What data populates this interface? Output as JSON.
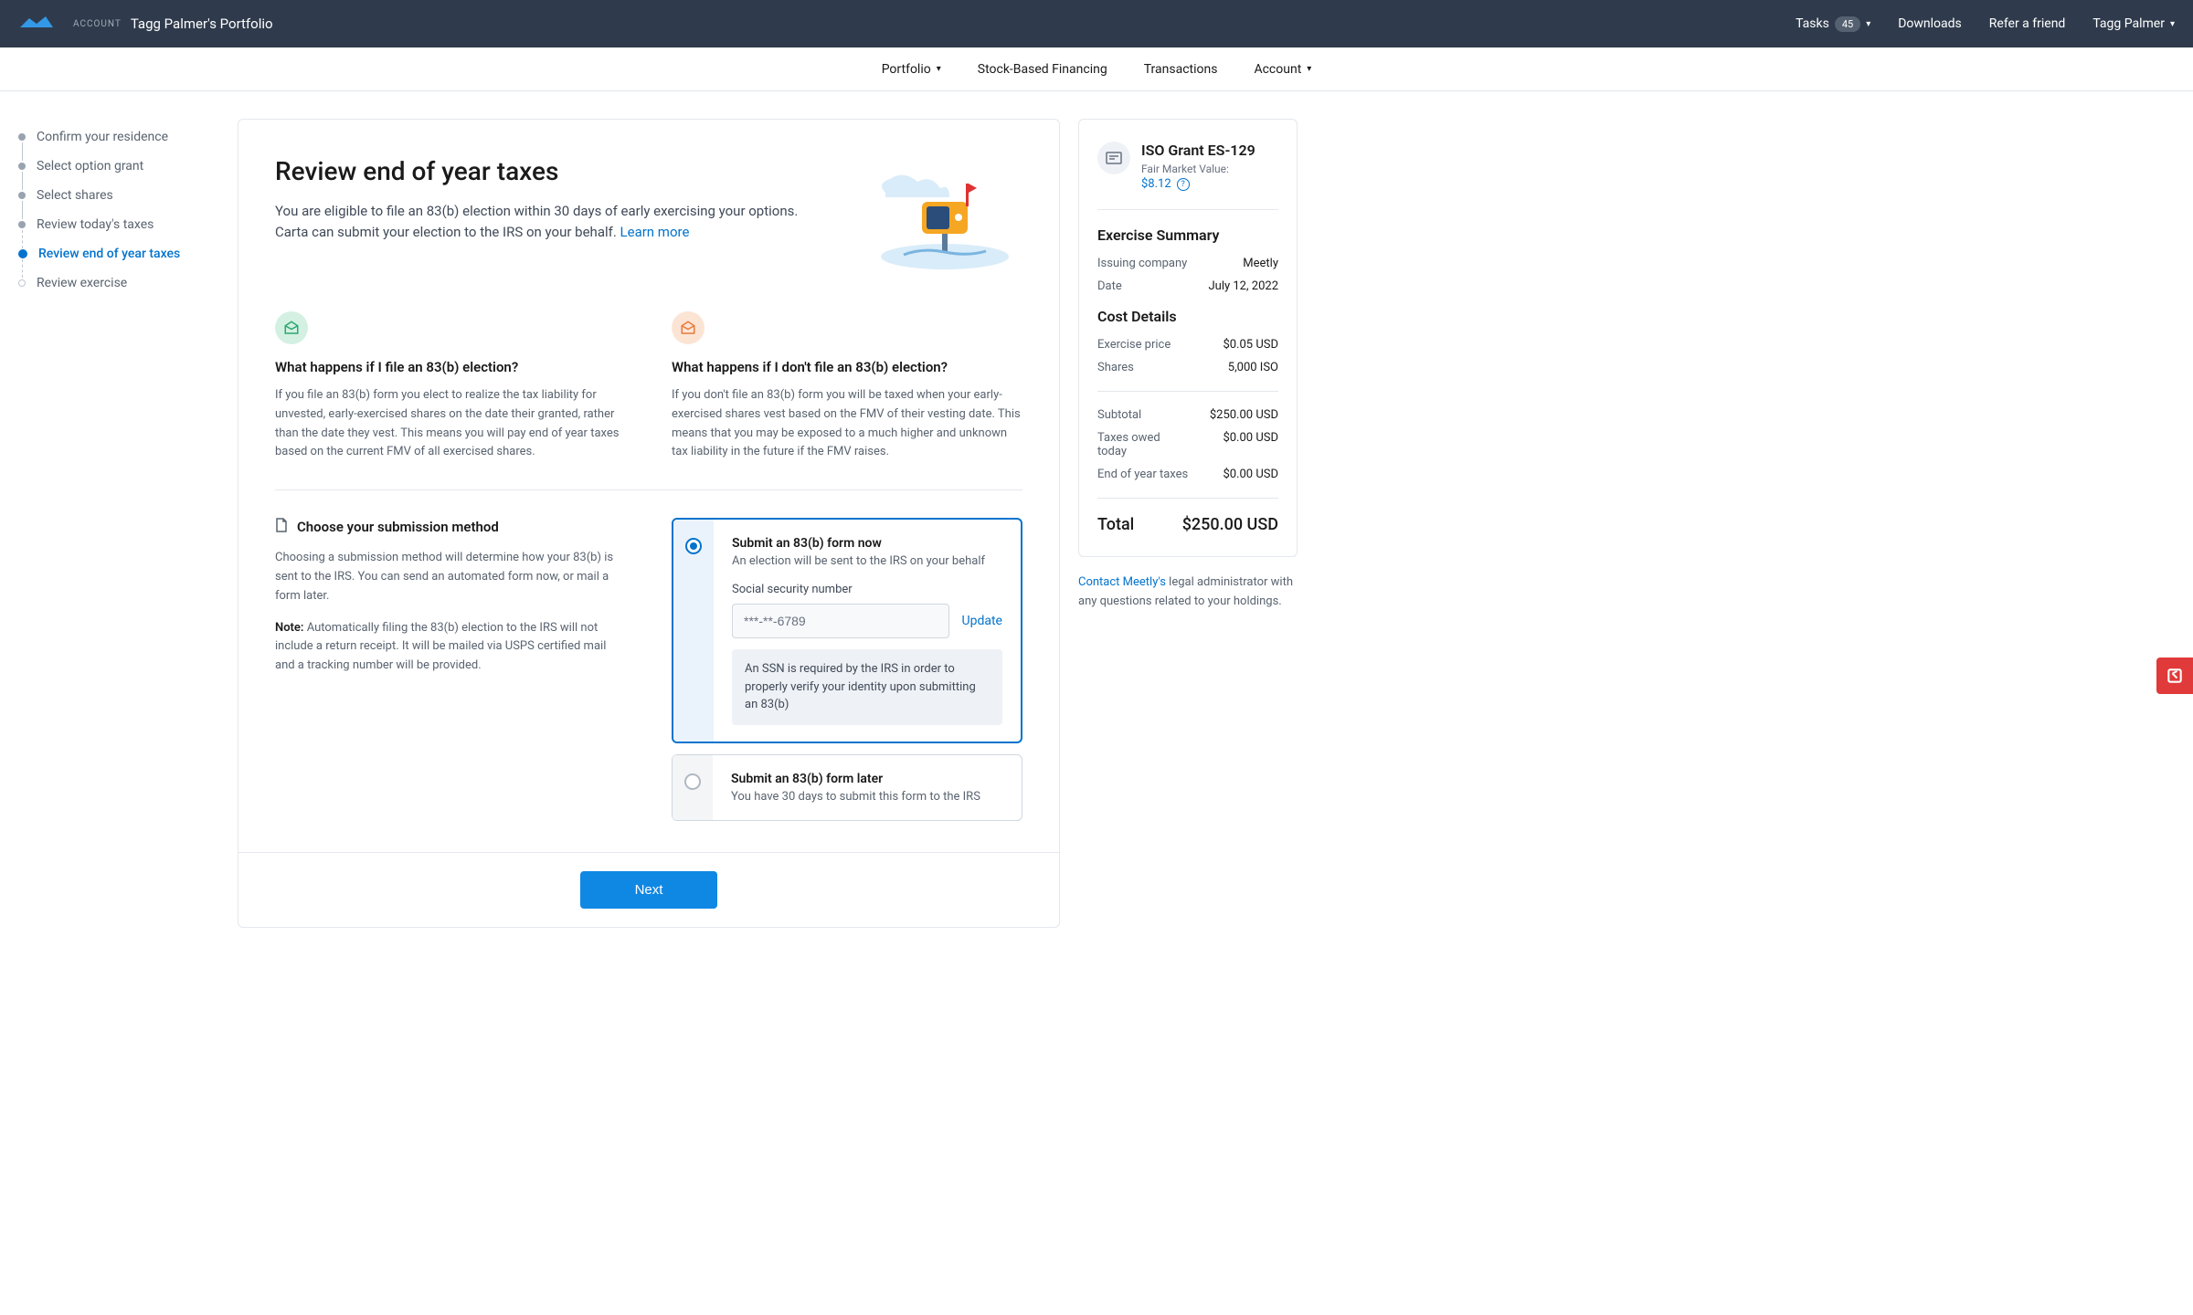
{
  "header": {
    "account_label": "ACCOUNT",
    "portfolio_name": "Tagg Palmer's Portfolio",
    "tasks_label": "Tasks",
    "tasks_count": "45",
    "downloads": "Downloads",
    "refer": "Refer a friend",
    "user_name": "Tagg Palmer"
  },
  "subnav": {
    "portfolio": "Portfolio",
    "financing": "Stock-Based Financing",
    "transactions": "Transactions",
    "account": "Account"
  },
  "steps": [
    {
      "label": "Confirm your residence"
    },
    {
      "label": "Select option grant"
    },
    {
      "label": "Select shares"
    },
    {
      "label": "Review today's taxes"
    },
    {
      "label": "Review end of year taxes"
    },
    {
      "label": "Review exercise"
    }
  ],
  "main": {
    "title": "Review end of year taxes",
    "desc": "You are eligible to file an 83(b) election within 30 days of early exercising your options. Carta can submit your election to the IRS on your behalf.",
    "learn_more": "Learn more",
    "col1_title": "What happens if I file an 83(b) election?",
    "col1_text": "If you file an 83(b) form you elect to realize the tax liability for unvested, early-exercised shares on the date their granted, rather than the date they vest. This means you will pay end of year taxes based on the current FMV of all exercised shares.",
    "col2_title": "What happens if I don't file an 83(b) election?",
    "col2_text": "If you don't file an 83(b) form you will be taxed when your early-exercised shares vest based on the FMV of their vesting date. This means that you may be exposed to a much higher and unknown tax liability in the future if the FMV raises.",
    "sub_heading": "Choose your submission method",
    "sub_text": "Choosing a submission method will determine how your 83(b) is sent to the IRS. You can send an automated form now, or mail a form later.",
    "note_label": "Note:",
    "note_text": " Automatically filing the 83(b) election to the IRS will not include a return receipt. It will be mailed via USPS certified mail and a tracking number will be provided.",
    "opt1_title": "Submit an 83(b) form now",
    "opt1_sub": "An election will be sent to the IRS on your behalf",
    "ssn_label": "Social security number",
    "ssn_value": "***-**-6789",
    "update": "Update",
    "ssn_note": "An SSN is required by the IRS in order to properly verify your identity upon submitting an 83(b)",
    "opt2_title": "Submit an 83(b) form later",
    "opt2_sub": "You have 30 days to submit this form to the IRS",
    "next": "Next"
  },
  "sidebar": {
    "grant_title": "ISO Grant ES-129",
    "fmv_label": "Fair Market Value:",
    "fmv_value": "$8.12",
    "summary_title": "Exercise Summary",
    "issuing_lbl": "Issuing company",
    "issuing_val": "Meetly",
    "date_lbl": "Date",
    "date_val": "July 12, 2022",
    "cost_title": "Cost Details",
    "price_lbl": "Exercise price",
    "price_val": "$0.05 USD",
    "shares_lbl": "Shares",
    "shares_val": "5,000 ISO",
    "subtotal_lbl": "Subtotal",
    "subtotal_val": "$250.00 USD",
    "taxtoday_lbl": "Taxes owed today",
    "taxtoday_val": "$0.00 USD",
    "eoy_lbl": "End of year taxes",
    "eoy_val": "$0.00 USD",
    "total_lbl": "Total",
    "total_val": "$250.00 USD",
    "contact_link": "Contact Meetly's",
    "contact_text": " legal administrator with any questions related to your holdings."
  }
}
